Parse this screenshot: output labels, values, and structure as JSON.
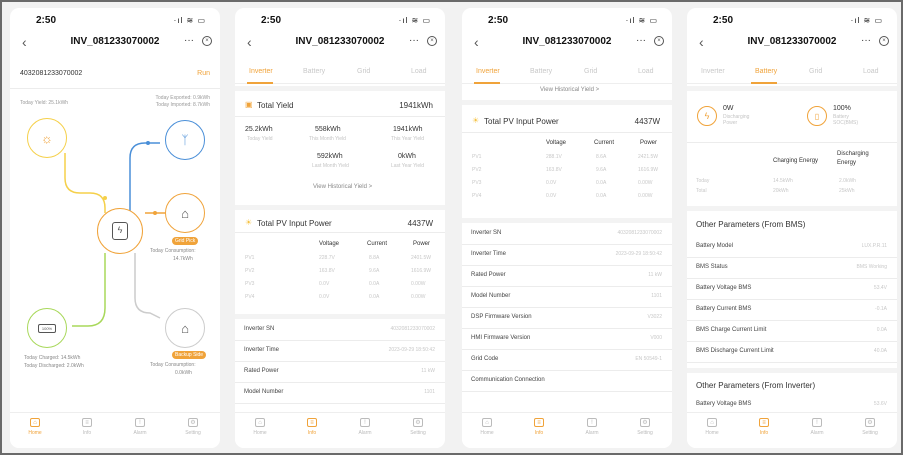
{
  "time": "2:50",
  "device_title": "INV_081233070002",
  "more": "···",
  "close": "⊗",
  "tabs": [
    "Inverter",
    "Battery",
    "Grid",
    "Load"
  ],
  "bottom_nav": [
    "Home",
    "Info",
    "Alarm",
    "Setting"
  ],
  "screen1": {
    "serial": "4032081233070002",
    "run": "Run",
    "today_yield": "Today Yield:  25.1kWh",
    "today_exported": "Today Exported:  0.9kWh",
    "today_imported": "Today Imported:  8.7kWh",
    "pv_label": "pv",
    "inverter_label": "inverter",
    "grid_label": "grid",
    "home_label": "HOME",
    "grid_pill": "Grid Pick",
    "today_consumption_1": "Today Consumption:",
    "consumption_1_value": "14.7kWh",
    "battery_pct": "100%",
    "battery_label": "BAT",
    "today_charged": "Today Charged:  14.5kWh",
    "today_discharged": "Today Discharged:  2.0kWh",
    "backup_pill": "Backup Side",
    "today_consumption_2": "Today Consumption:",
    "consumption_2_value": "0.0kWh",
    "bp_label": "BP"
  },
  "screen2": {
    "total_yield_label": "Total Yield",
    "total_yield_value": "1941kWh",
    "yields": [
      {
        "value": "25.2kWh",
        "label": "Today Yield"
      },
      {
        "value": "558kWh",
        "label": "This Month Yield"
      },
      {
        "value": "1941kWh",
        "label": "This Year Yield"
      },
      {
        "value": "592kWh",
        "label": "Last Month Yield"
      },
      {
        "value": "0kWh",
        "label": "Last Year Yield"
      }
    ],
    "history_link": "View Historical Yield >",
    "pv_input_label": "Total PV Input Power",
    "pv_input_value": "4437W",
    "col_voltage": "Voltage",
    "col_current": "Current",
    "col_power": "Power",
    "pv_rows": [
      [
        "PV1",
        "228.7V",
        "8.8A",
        "2401.5W"
      ],
      [
        "PV2",
        "163.8V",
        "9.6A",
        "1616.9W"
      ],
      [
        "PV3",
        "0.0V",
        "0.0A",
        "0.00W"
      ],
      [
        "PV4",
        "0.0V",
        "0.0A",
        "0.00W"
      ]
    ],
    "info_rows": [
      [
        "Inverter SN",
        "4032081233070002"
      ],
      [
        "Inverter Time",
        "2023-09-29 18:50:42"
      ],
      [
        "Rated Power",
        "11 kW"
      ],
      [
        "Model Number",
        "1101"
      ]
    ]
  },
  "screen3": {
    "history_link": "View Historical Yield >",
    "pv_input_label": "Total PV Input Power",
    "pv_input_value": "4437W",
    "col_voltage": "Voltage",
    "col_current": "Current",
    "col_power": "Power",
    "pv_rows": [
      [
        "PV1",
        "288.1V",
        "8.6A",
        "2421.5W"
      ],
      [
        "PV2",
        "163.8V",
        "9.6A",
        "1616.9W"
      ],
      [
        "PV3",
        "0.0V",
        "0.0A",
        "0.00W"
      ],
      [
        "PV4",
        "0.0V",
        "0.0A",
        "0.00W"
      ]
    ],
    "info_rows": [
      [
        "Inverter SN",
        "4032081233070002"
      ],
      [
        "Inverter Time",
        "2023-09-29 18:50:42"
      ],
      [
        "Rated Power",
        "11 kW"
      ],
      [
        "Model Number",
        "1101"
      ],
      [
        "DSP Firmware Version",
        "V3022"
      ],
      [
        "HMI Firmware Version",
        "V000"
      ],
      [
        "Grid Code",
        "EN 50549-1"
      ],
      [
        "Communication Connection",
        ""
      ]
    ]
  },
  "screen4": {
    "power_value": "0W",
    "power_label": "Discharging Power",
    "soc_value": "100%",
    "soc_label": "Battery SOC(BMS)",
    "col_charging": "Charging Energy",
    "col_discharging": "Discharging Energy",
    "energy_rows": [
      [
        "Today",
        "14.5kWh",
        "2.0kWh"
      ],
      [
        "Total",
        "20kWh",
        "25kWh"
      ]
    ],
    "bms_header": "Other Parameters (From BMS)",
    "bms_rows": [
      [
        "Battery Model",
        "LUX.P.R.11"
      ],
      [
        "BMS Status",
        "BMS Working"
      ],
      [
        "Battery Voltage BMS",
        "53.4V"
      ],
      [
        "Battery Current BMS",
        "-0.1A"
      ],
      [
        "BMS Charge Current Limit",
        "0.0A"
      ],
      [
        "BMS Discharge Current Limit",
        "40.0A"
      ]
    ],
    "inv_header": "Other Parameters (From Inverter)",
    "inv_rows": [
      [
        "Battery Voltage BMS",
        "53.6V"
      ]
    ]
  },
  "colors": {
    "accent": "#f0a33a",
    "pv_line": "#f5d04a",
    "grid_line": "#4a8fd8",
    "battery_line": "#a8d85a",
    "backup_line": "#c8c8c8"
  }
}
